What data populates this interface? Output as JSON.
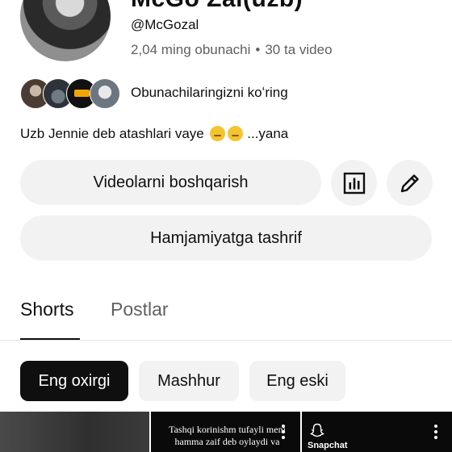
{
  "channel": {
    "name": "McGo Zal(uzb)",
    "handle": "@McGozal",
    "subscribers": "2,04 ming obunachi",
    "separator": "•",
    "videos": "30 ta video",
    "subscribers_link": "Obunachilaringizni koʻring",
    "description_text": "Uzb Jennie deb atashlari vaye",
    "description_more": "...yana"
  },
  "buttons": {
    "manage_videos": "Videolarni boshqarish",
    "analytics_icon": "analytics-icon",
    "edit_icon": "pencil-icon",
    "visit_community": "Hamjamiyatga tashrif"
  },
  "tabs": [
    {
      "label": "Shorts",
      "active": true
    },
    {
      "label": "Postlar",
      "active": false
    }
  ],
  "filters": [
    {
      "label": "Eng oxirgi",
      "selected": true
    },
    {
      "label": "Mashhur",
      "selected": false
    },
    {
      "label": "Eng eski",
      "selected": false
    }
  ],
  "shorts": [
    {
      "caption": ""
    },
    {
      "caption": "Tashqi korinishm tufayli meni hamma zaif deb oylaydi va"
    },
    {
      "caption": "",
      "app_label": "Snapchat"
    }
  ],
  "colors": {
    "text_primary": "#0f0f0f",
    "text_secondary": "#606060",
    "chip_bg": "#f2f2f2",
    "chip_selected_bg": "#0f0f0f"
  }
}
